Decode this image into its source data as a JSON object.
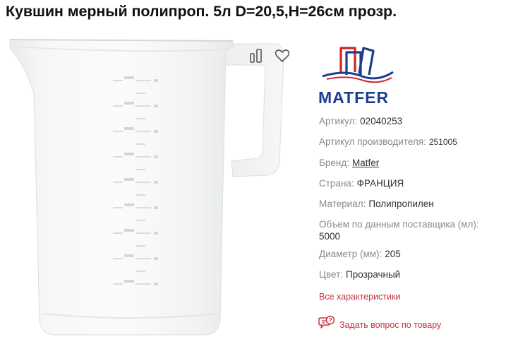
{
  "product": {
    "title": "Кувшин мерный полипроп. 5л D=20,5,H=26см прозр."
  },
  "actions": {
    "compare_icon": "compare-icon",
    "favorite_icon": "heart-icon"
  },
  "brand": {
    "logo_text": "MATFER"
  },
  "specs": {
    "article_label": "Артикул:",
    "article_value": "02040253",
    "mfr_article_label": "Артикул производителя:",
    "mfr_article_value": "251005",
    "brand_label": "Бренд:",
    "brand_value": "Matfer",
    "country_label": "Страна:",
    "country_value": "ФРАНЦИЯ",
    "material_label": "Материал:",
    "material_value": "Полипропилен",
    "volume_label": "Объем по данным поставщика (мл):",
    "volume_value": "5000",
    "diameter_label": "Диаметр (мм):",
    "diameter_value": "205",
    "color_label": "Цвет:",
    "color_value": "Прозрачный"
  },
  "links": {
    "all_specs": "Все характеристики",
    "ask_question": "Задать вопрос по товару"
  },
  "colors": {
    "accent": "#c8323c",
    "label_gray": "#8a8a8a",
    "logo_blue": "#1c3d8c",
    "logo_red": "#d2232a"
  }
}
